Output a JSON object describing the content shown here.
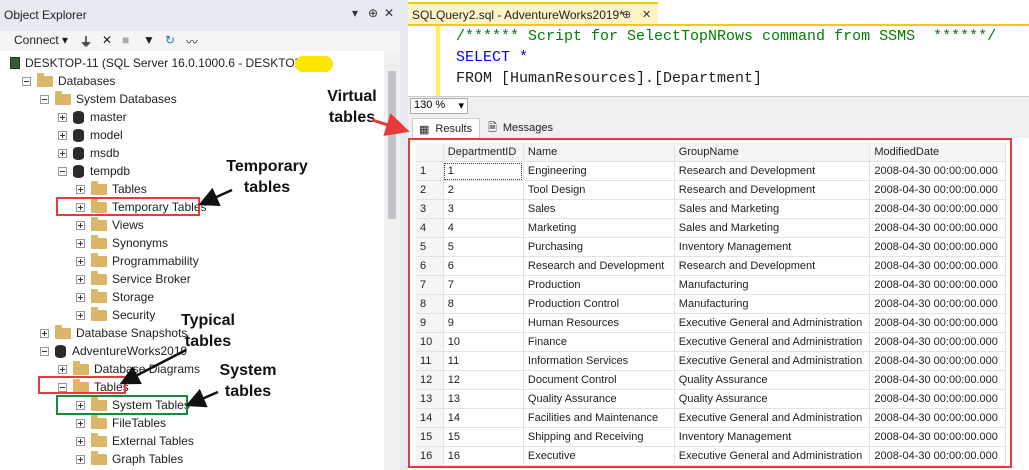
{
  "object_explorer": {
    "title": "Object Explorer",
    "controls": [
      "▾",
      "⊕",
      "✕"
    ],
    "toolbar": {
      "connect": "Connect"
    },
    "tree": [
      {
        "label": "DESKTOP-11 (SQL Server 16.0.1000.6 - DESKTOP-11\\",
        "kind": "server",
        "indent": 0,
        "expander": "minus"
      },
      {
        "label": "Databases",
        "kind": "folder",
        "indent": 1,
        "expander": "minus"
      },
      {
        "label": "System Databases",
        "kind": "folder",
        "indent": 2,
        "expander": "minus"
      },
      {
        "label": "master",
        "kind": "db",
        "indent": 3,
        "expander": "plus"
      },
      {
        "label": "model",
        "kind": "db",
        "indent": 3,
        "expander": "plus"
      },
      {
        "label": "msdb",
        "kind": "db",
        "indent": 3,
        "expander": "plus"
      },
      {
        "label": "tempdb",
        "kind": "db",
        "indent": 3,
        "expander": "minus"
      },
      {
        "label": "Tables",
        "kind": "folder",
        "indent": 4,
        "expander": "plus"
      },
      {
        "label": "Temporary Tables",
        "kind": "folder",
        "indent": 4,
        "expander": "plus"
      },
      {
        "label": "Views",
        "kind": "folder",
        "indent": 4,
        "expander": "plus"
      },
      {
        "label": "Synonyms",
        "kind": "folder",
        "indent": 4,
        "expander": "plus"
      },
      {
        "label": "Programmability",
        "kind": "folder",
        "indent": 4,
        "expander": "plus"
      },
      {
        "label": "Service Broker",
        "kind": "folder",
        "indent": 4,
        "expander": "plus"
      },
      {
        "label": "Storage",
        "kind": "folder",
        "indent": 4,
        "expander": "plus"
      },
      {
        "label": "Security",
        "kind": "folder",
        "indent": 4,
        "expander": "plus"
      },
      {
        "label": "Database Snapshots",
        "kind": "folder",
        "indent": 2,
        "expander": "plus"
      },
      {
        "label": "AdventureWorks2019",
        "kind": "db",
        "indent": 2,
        "expander": "minus"
      },
      {
        "label": "Database Diagrams",
        "kind": "folder",
        "indent": 3,
        "expander": "plus"
      },
      {
        "label": "Tables",
        "kind": "folder",
        "indent": 3,
        "expander": "minus"
      },
      {
        "label": "System Tables",
        "kind": "folder",
        "indent": 4,
        "expander": "plus"
      },
      {
        "label": "FileTables",
        "kind": "folder",
        "indent": 4,
        "expander": "plus"
      },
      {
        "label": "External Tables",
        "kind": "folder",
        "indent": 4,
        "expander": "plus"
      },
      {
        "label": "Graph Tables",
        "kind": "folder",
        "indent": 4,
        "expander": "plus"
      }
    ]
  },
  "query": {
    "tab_title": "SQLQuery2.sql - AdventureWorks2019*",
    "tab_pin": "⊕",
    "tab_close": "✕",
    "code_lines": [
      "/****** Script for SelectTopNRows command from SSMS  ******/",
      "SELECT *",
      "FROM [HumanResources].[Department]"
    ],
    "zoom": "130 %"
  },
  "results": {
    "tabs": [
      "Results",
      "Messages"
    ],
    "columns": [
      "",
      "DepartmentID",
      "Name",
      "GroupName",
      "ModifiedDate"
    ],
    "rows": [
      [
        "1",
        "1",
        "Engineering",
        "Research and Development",
        "2008-04-30 00:00:00.000"
      ],
      [
        "2",
        "2",
        "Tool Design",
        "Research and Development",
        "2008-04-30 00:00:00.000"
      ],
      [
        "3",
        "3",
        "Sales",
        "Sales and Marketing",
        "2008-04-30 00:00:00.000"
      ],
      [
        "4",
        "4",
        "Marketing",
        "Sales and Marketing",
        "2008-04-30 00:00:00.000"
      ],
      [
        "5",
        "5",
        "Purchasing",
        "Inventory Management",
        "2008-04-30 00:00:00.000"
      ],
      [
        "6",
        "6",
        "Research and Development",
        "Research and Development",
        "2008-04-30 00:00:00.000"
      ],
      [
        "7",
        "7",
        "Production",
        "Manufacturing",
        "2008-04-30 00:00:00.000"
      ],
      [
        "8",
        "8",
        "Production Control",
        "Manufacturing",
        "2008-04-30 00:00:00.000"
      ],
      [
        "9",
        "9",
        "Human Resources",
        "Executive General and Administration",
        "2008-04-30 00:00:00.000"
      ],
      [
        "10",
        "10",
        "Finance",
        "Executive General and Administration",
        "2008-04-30 00:00:00.000"
      ],
      [
        "11",
        "11",
        "Information Services",
        "Executive General and Administration",
        "2008-04-30 00:00:00.000"
      ],
      [
        "12",
        "12",
        "Document Control",
        "Quality Assurance",
        "2008-04-30 00:00:00.000"
      ],
      [
        "13",
        "13",
        "Quality Assurance",
        "Quality Assurance",
        "2008-04-30 00:00:00.000"
      ],
      [
        "14",
        "14",
        "Facilities and Maintenance",
        "Executive General and Administration",
        "2008-04-30 00:00:00.000"
      ],
      [
        "15",
        "15",
        "Shipping and Receiving",
        "Inventory Management",
        "2008-04-30 00:00:00.000"
      ],
      [
        "16",
        "16",
        "Executive",
        "Executive General and Administration",
        "2008-04-30 00:00:00.000"
      ]
    ]
  },
  "annotations": {
    "virtual": "Virtual\ntables",
    "temporary": "Temporary\ntables",
    "typical": "Typical\ntables",
    "system": "System\ntables"
  },
  "colors": {
    "red_box": "#e83a3a",
    "green_box": "#1a8a3a",
    "tab_accent": "#f5cc00",
    "comment": "#008000",
    "keyword": "#0000ff"
  }
}
